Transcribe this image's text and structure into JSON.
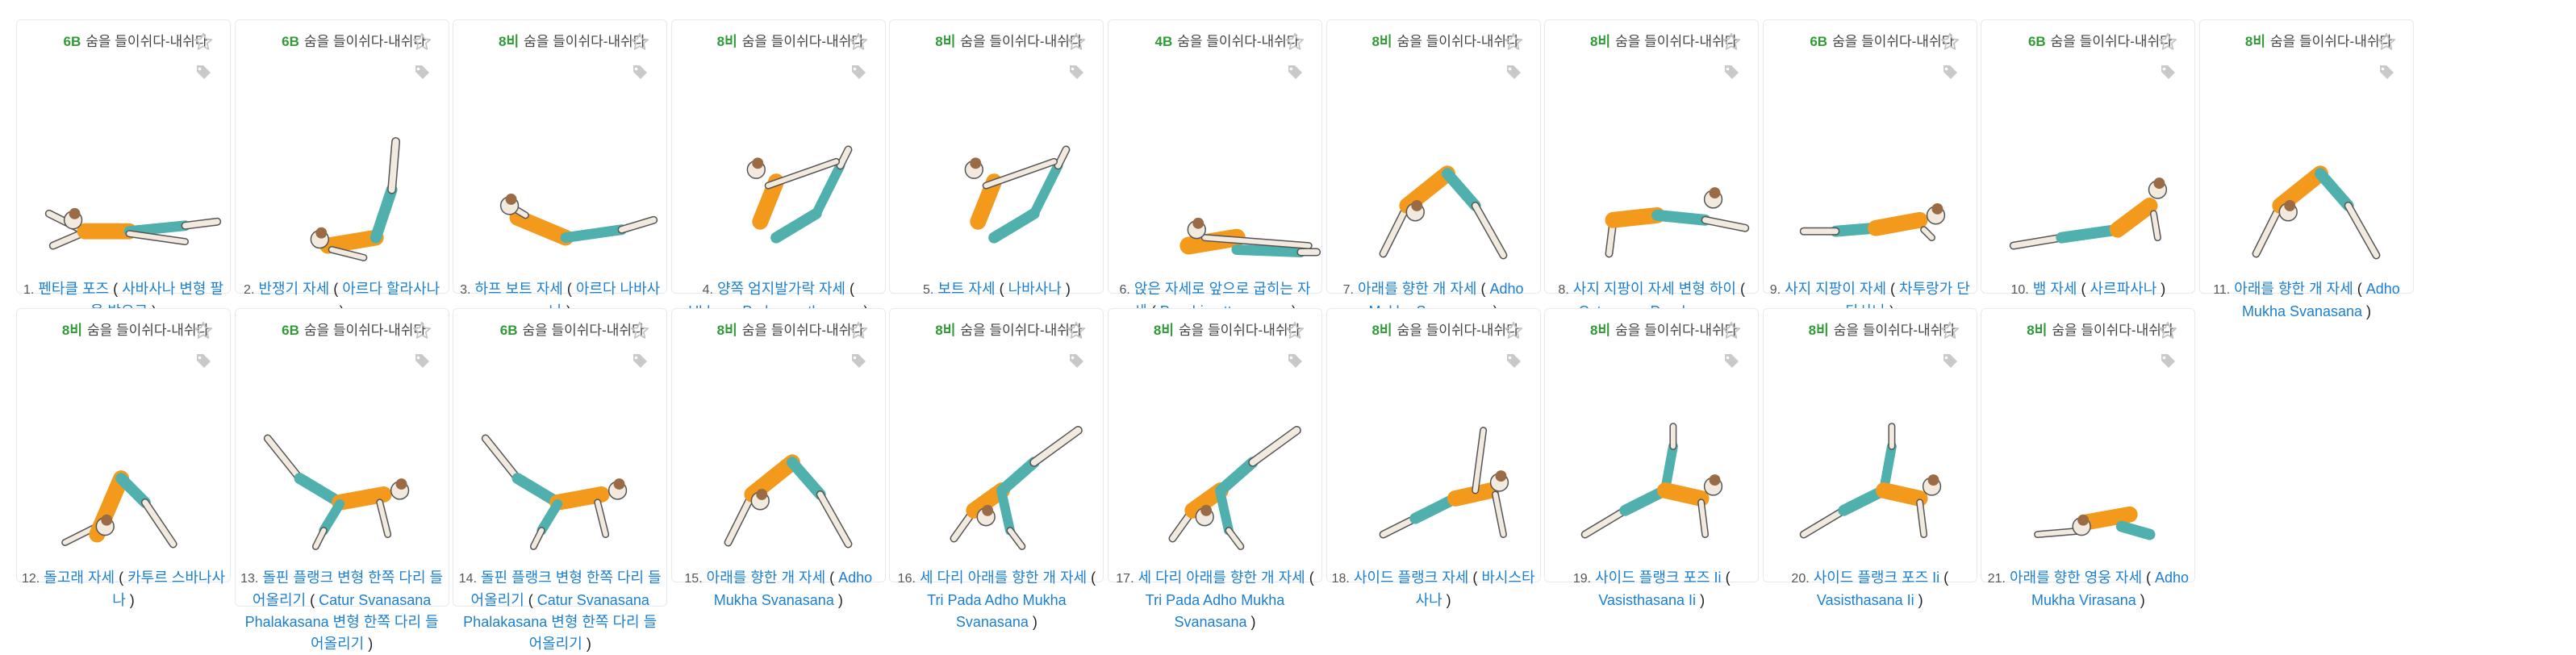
{
  "level_label": "숨을 들이쉬다-내쉬다",
  "colors": {
    "level": "#2f9a36",
    "link": "#1b7fd1",
    "top": "#f39a1c",
    "bottom": "#4fb0ad",
    "skin": "#f2e9df",
    "hair": "#9a6b45"
  },
  "poses": [
    {
      "num": "1.",
      "level": "6B",
      "name": "펜타클 포즈",
      "sub": "사바사나 변형 팔을 밖으로",
      "shape": "lying"
    },
    {
      "num": "2.",
      "level": "6B",
      "name": "반쟁기 자세",
      "sub": "아르다 할라사나",
      "shape": "legsup"
    },
    {
      "num": "3.",
      "level": "8비",
      "name": "하프 보트 자세",
      "sub": "아르다 나바사나",
      "shape": "halfboat"
    },
    {
      "num": "4.",
      "level": "8비",
      "name": "양쪽 엄지발가락 자세",
      "sub": "Ubhaya Padangusthasana",
      "shape": "boat"
    },
    {
      "num": "5.",
      "level": "8비",
      "name": "보트 자세",
      "sub": "나바사나",
      "shape": "boat"
    },
    {
      "num": "6.",
      "level": "4B",
      "name": "앉은 자세로 앞으로 굽히는 자세",
      "sub": "Paschimottanasana",
      "shape": "forward"
    },
    {
      "num": "7.",
      "level": "8비",
      "name": "아래를 향한 개 자세",
      "sub": "Adho Mukha Svanasana",
      "shape": "dog"
    },
    {
      "num": "8.",
      "level": "8비",
      "name": "사지 지팡이 자세 변형 하이",
      "sub": "Caturanga Dandasana Variation",
      "shape": "plank"
    },
    {
      "num": "9.",
      "level": "6B",
      "name": "사지 지팡이 자세",
      "sub": "차투랑가 단다사나",
      "shape": "chaturanga"
    },
    {
      "num": "10.",
      "level": "6B",
      "name": "뱀 자세",
      "sub": "사르파사나",
      "shape": "cobra"
    },
    {
      "num": "11.",
      "level": "8비",
      "name": "아래를 향한 개 자세",
      "sub": "Adho Mukha Svanasana",
      "shape": "dog"
    },
    {
      "num": "12.",
      "level": "8비",
      "name": "돌고래 자세",
      "sub": "카투르 스바나사나",
      "shape": "dolphin"
    },
    {
      "num": "13.",
      "level": "6B",
      "name": "돌핀 플랭크 변형 한쪽 다리 들어올리기",
      "sub": "Catur Svanasana Phalakasana 변형 한쪽 다리 들어올리기",
      "shape": "legraise"
    },
    {
      "num": "14.",
      "level": "6B",
      "name": "돌핀 플랭크 변형 한쪽 다리 들어올리기",
      "sub": "Catur Svanasana Phalakasana 변형 한쪽 다리 들어올리기",
      "shape": "legraise"
    },
    {
      "num": "15.",
      "level": "8비",
      "name": "아래를 향한 개 자세",
      "sub": "Adho Mukha Svanasana",
      "shape": "dog"
    },
    {
      "num": "16.",
      "level": "8비",
      "name": "세 다리 아래를 향한 개 자세",
      "sub": "Tri Pada Adho Mukha Svanasana",
      "shape": "threeleg"
    },
    {
      "num": "17.",
      "level": "8비",
      "name": "세 다리 아래를 향한 개 자세",
      "sub": "Tri Pada Adho Mukha Svanasana",
      "shape": "threeleg"
    },
    {
      "num": "18.",
      "level": "8비",
      "name": "사이드 플랭크 자세",
      "sub": "바시스타사나",
      "shape": "sideplank"
    },
    {
      "num": "19.",
      "level": "8비",
      "name": "사이드 플랭크 포즈 Ii",
      "sub": "Vasisthasana Ii",
      "shape": "sideplank2"
    },
    {
      "num": "20.",
      "level": "8비",
      "name": "사이드 플랭크 포즈 Ii",
      "sub": "Vasisthasana Ii",
      "shape": "sideplank2"
    },
    {
      "num": "21.",
      "level": "8비",
      "name": "아래를 향한 영웅 자세",
      "sub": "Adho Mukha Virasana",
      "shape": "child"
    }
  ]
}
